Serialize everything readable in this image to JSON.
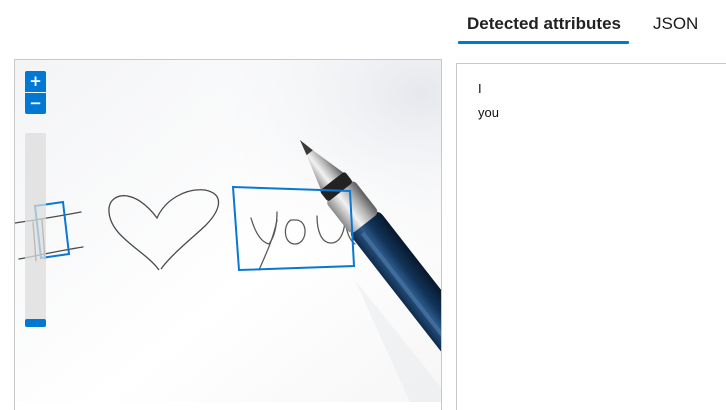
{
  "tabs": [
    {
      "label": "Detected attributes",
      "active": true
    },
    {
      "label": "JSON",
      "active": false
    }
  ],
  "accent_color": "#0078d4",
  "zoom": {
    "in_label": "+",
    "out_label": "−",
    "level": 0.0
  },
  "image": {
    "description_icon": "handwriting-photo",
    "detected_words": [
      "I",
      "you"
    ]
  },
  "attributes": {
    "lines": [
      "I",
      "you"
    ]
  }
}
